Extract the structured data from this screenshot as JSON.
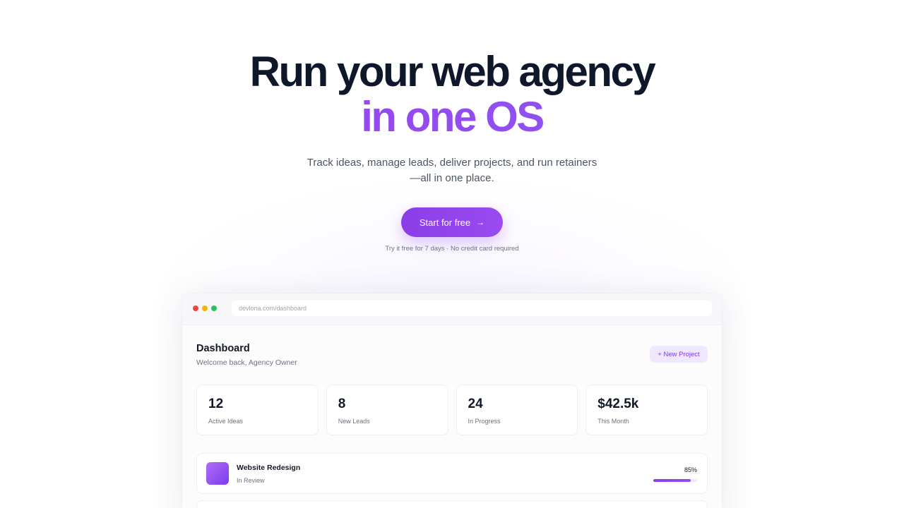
{
  "hero": {
    "title_line1": "Run your web agency",
    "title_line2": "in one OS",
    "subtitle_line1": "Track ideas, manage leads, deliver projects, and run retainers",
    "subtitle_line2": "—all in one place.",
    "cta_label": "Start for free",
    "cta_icon": "arrow-right-icon",
    "cta_note": "Try it free for 7 days · No credit card required",
    "accent_color": "#8b3ee8"
  },
  "browser": {
    "url": "devlona.com/dashboard",
    "window_controls": [
      "#ef4444",
      "#f5b800",
      "#22c55e"
    ]
  },
  "dashboard": {
    "title": "Dashboard",
    "welcome": "Welcome back, Agency Owner",
    "new_project_label": "+ New Project",
    "stats": [
      {
        "value": "12",
        "label": "Active Ideas"
      },
      {
        "value": "8",
        "label": "New Leads"
      },
      {
        "value": "24",
        "label": "In Progress"
      },
      {
        "value": "$42.5k",
        "label": "This Month"
      }
    ],
    "projects": [
      {
        "name": "Website Redesign",
        "status": "In Review",
        "percent_label": "85%",
        "progress": 0.85
      }
    ]
  }
}
